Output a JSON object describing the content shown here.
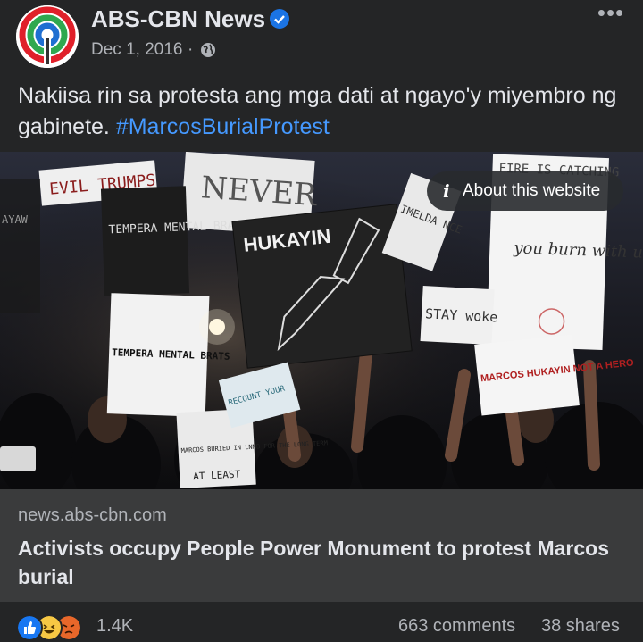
{
  "post": {
    "page_name": "ABS-CBN News",
    "date": "Dec 1, 2016",
    "separator": "·",
    "caption_text": "Nakiisa rin sa protesta ang mga dati at ngayo'y miyembro ng gabinete.",
    "hashtag": "#MarcosBurialProtest",
    "more_label": "•••"
  },
  "image": {
    "signs": [
      "EVIL TRUMPS",
      "NEVER",
      "TEMPERA MENTAL BRAT",
      "HUKAYIN",
      "FIRE IS CATCHING",
      "you burn with us",
      "STAY woke",
      "MARCOS HUKAYIN NOT A HERO",
      "TEMPERA MENTAL BRATS",
      "MARCOS BURIED IN LNMB FOR THE LONG TERM",
      "AT LEAST",
      "RECOUNT YOUR",
      "IMELDA NCE",
      "AYAW"
    ]
  },
  "about_site": {
    "icon": "i",
    "label": "About this website"
  },
  "link": {
    "domain": "news.abs-cbn.com",
    "title": "Activists occupy People Power Monument to protest Marcos burial"
  },
  "footer": {
    "reaction_count": "1.4K",
    "comments": "663 comments",
    "shares": "38 shares"
  },
  "colors": {
    "background": "#242526",
    "link_box": "#3a3b3c",
    "hashtag": "#4599ff",
    "verified": "#1b74e4"
  }
}
